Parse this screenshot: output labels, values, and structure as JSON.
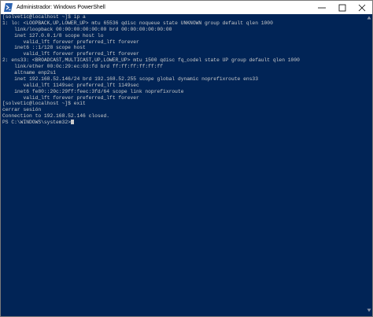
{
  "window": {
    "title": "Administrador: Windows PowerShell"
  },
  "terminal": {
    "lines": [
      "[solvetic@localhost ~]$ ip a",
      "1: lo: <LOOPBACK,UP,LOWER_UP> mtu 65536 qdisc noqueue state UNKNOWN group default qlen 1000",
      "    link/loopback 00:00:00:00:00:00 brd 00:00:00:00:00:00",
      "    inet 127.0.0.1/8 scope host lo",
      "       valid_lft forever preferred_lft forever",
      "    inet6 ::1/128 scope host",
      "       valid_lft forever preferred_lft forever",
      "2: ens33: <BROADCAST,MULTICAST,UP,LOWER_UP> mtu 1500 qdisc fq_codel state UP group default qlen 1000",
      "    link/ether 00:0c:29:ec:03:fd brd ff:ff:ff:ff:ff:ff",
      "    altname enp2s1",
      "    inet 192.168.52.146/24 brd 192.168.52.255 scope global dynamic noprefixroute ens33",
      "       valid_lft 1149sec preferred_lft 1149sec",
      "    inet6 fe80::20c:29ff:feec:3fd/64 scope link noprefixroute",
      "       valid_lft forever preferred_lft forever",
      "[solvetic@localhost ~]$ exit",
      "cerrar sesión",
      "Connection to 192.168.52.146 closed.",
      "PS C:\\WINDOWS\\system32>"
    ],
    "colors": {
      "background": "#012456",
      "foreground": "#cccccc"
    }
  },
  "icons": {
    "app": "powershell-icon",
    "minimize": "minimize-icon",
    "maximize": "maximize-icon",
    "close": "close-icon",
    "scroll_up": "scroll-up-arrow-icon",
    "scroll_down": "scroll-down-arrow-icon"
  }
}
